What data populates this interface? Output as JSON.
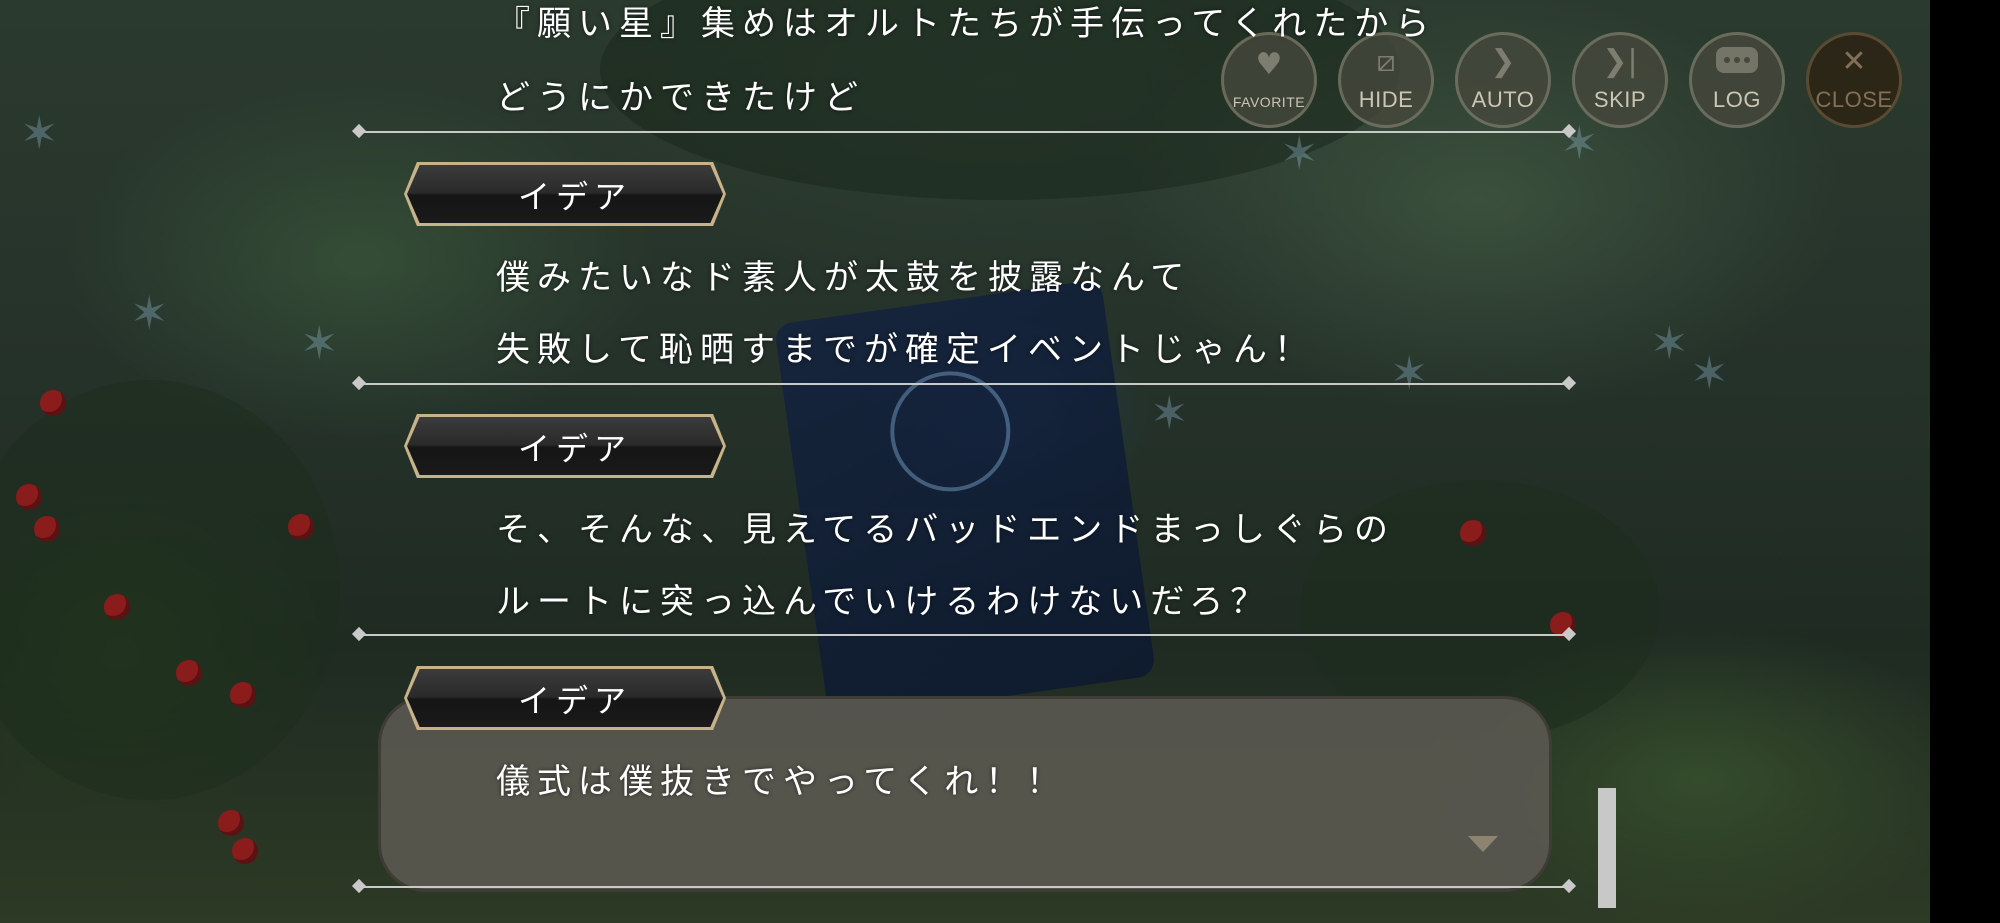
{
  "log": {
    "entries": [
      {
        "speaker": "",
        "lines": [
          "『願い星』集めはオルトたちが手伝ってくれたから",
          "どうにかできたけど"
        ]
      },
      {
        "speaker": "イデア",
        "lines": [
          "僕みたいなド素人が太鼓を披露なんて",
          "失敗して恥晒すまでが確定イベントじゃん！"
        ]
      },
      {
        "speaker": "イデア",
        "lines": [
          "そ、そんな、見えてるバッドエンドまっしぐらの",
          "ルートに突っ込んでいけるわけないだろ？"
        ]
      },
      {
        "speaker": "イデア",
        "lines": [
          "儀式は僕抜きでやってくれ！！"
        ]
      }
    ]
  },
  "controls": {
    "favorite": {
      "label": "FAVORITE",
      "icon": "heart-icon"
    },
    "hide": {
      "label": "HIDE",
      "icon": "hide-icon"
    },
    "auto": {
      "label": "AUTO",
      "icon": "play-arrow-icon"
    },
    "skip": {
      "label": "SKIP",
      "icon": "skip-icon"
    },
    "log": {
      "label": "LOG",
      "icon": "chat-bubble-icon"
    },
    "close": {
      "label": "CLOSE",
      "icon": "close-icon"
    }
  },
  "colors": {
    "name_plate_border": "#c7b389",
    "text": "#ffffff",
    "divider": "#c9c9c9"
  }
}
